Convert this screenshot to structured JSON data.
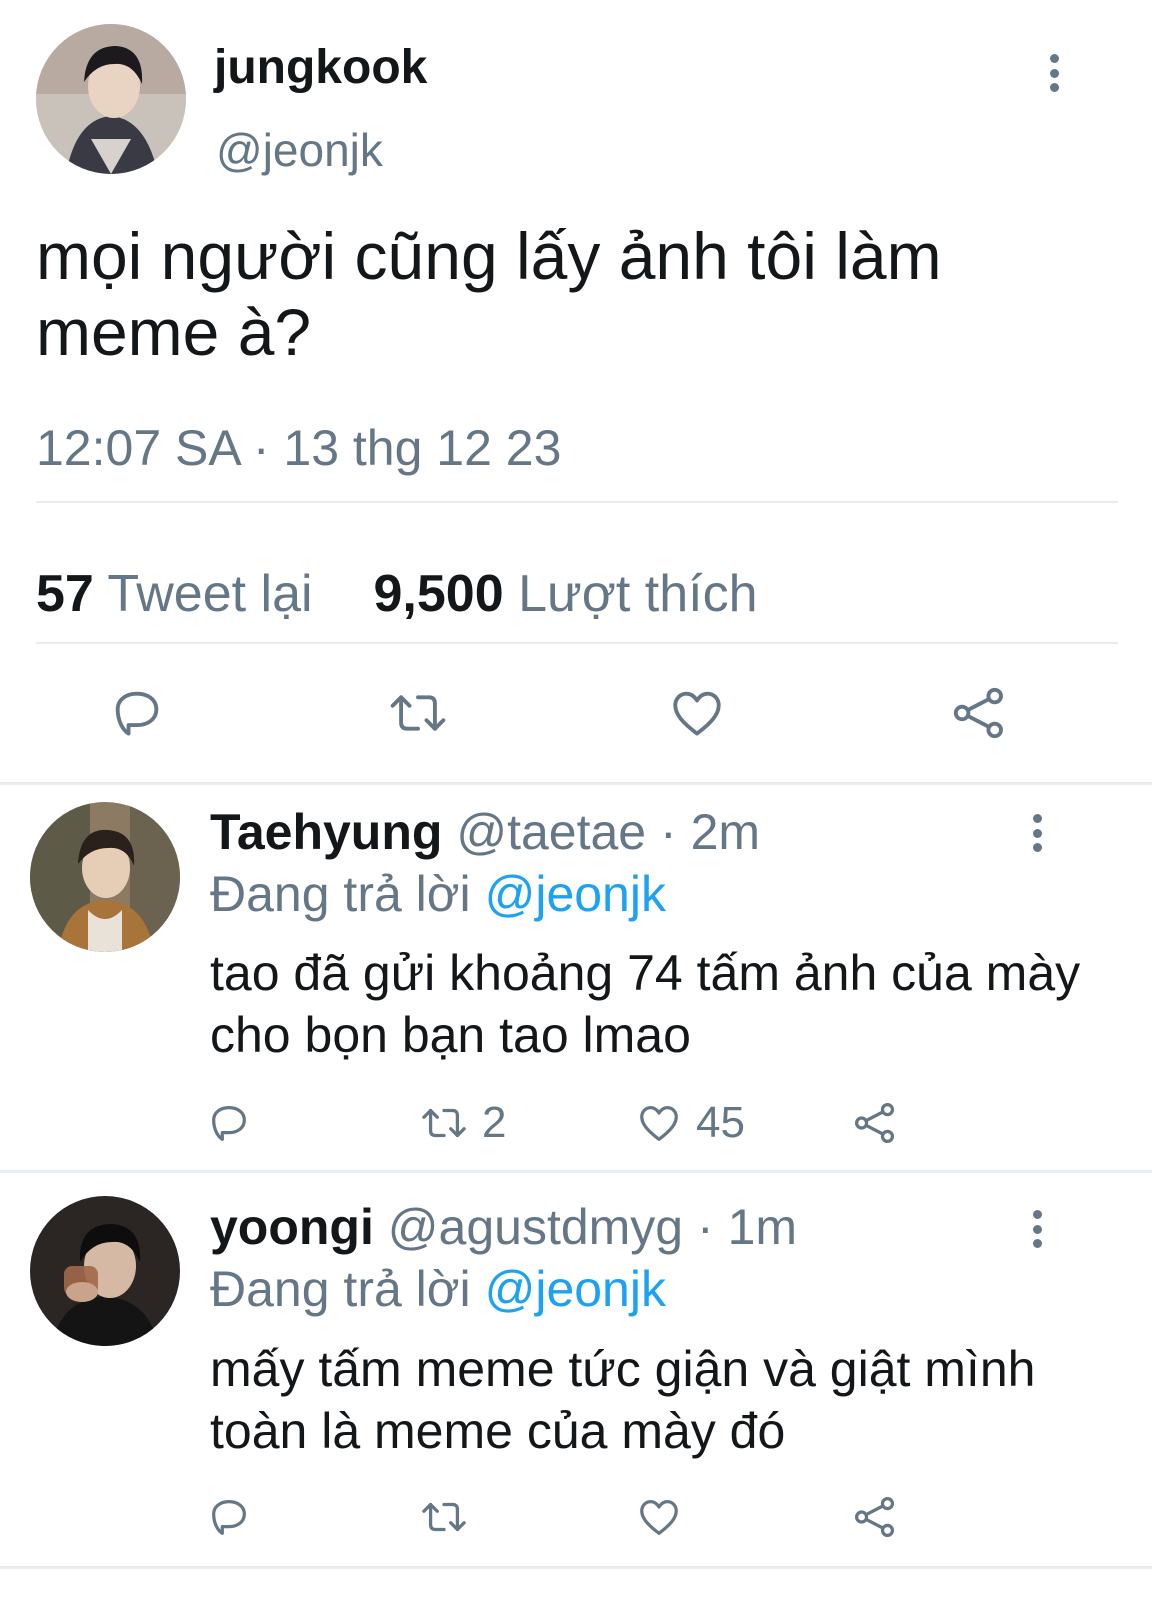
{
  "main_tweet": {
    "name": "jungkook",
    "handle": "@jeonjk",
    "text": "mọi người cũng lấy ảnh tôi làm meme à?",
    "timestamp": "12:07 SA · 13 thg 12 23",
    "retweets": "57",
    "retweets_label": "Tweet lại",
    "likes": "9,500",
    "likes_label": "Lượt thích",
    "actions": [
      "reply-icon",
      "retweet-icon",
      "like-icon",
      "share-icon"
    ]
  },
  "replies": [
    {
      "name": "Taehyung",
      "handle": "@taetae",
      "sep": "·",
      "time": "2m",
      "replying_label": "Đang trả lời",
      "replying_to": "@jeonjk",
      "text": "tao đã gửi khoảng 74 tấm ảnh của mày cho bọn bạn tao lmao",
      "retweet_count": "2",
      "like_count": "45"
    },
    {
      "name": "yoongi",
      "handle": "@agustdmyg",
      "sep": "·",
      "time": "1m",
      "replying_label": "Đang trả lời",
      "replying_to": "@jeonjk",
      "text": "mấy tấm meme tức giận và giật mình toàn là meme của mày đó",
      "retweet_count": "",
      "like_count": ""
    }
  ],
  "colors": {
    "text": "#14171a",
    "secondary": "#657786",
    "link": "#1da1f2",
    "divider": "#e6ecf0"
  }
}
